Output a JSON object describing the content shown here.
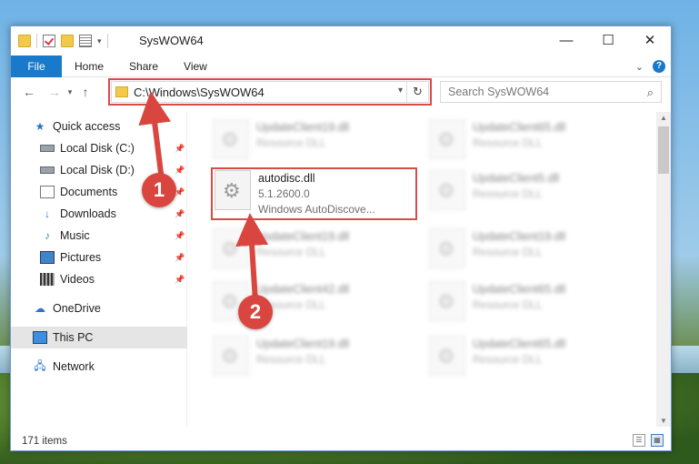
{
  "window": {
    "title": "SysWOW64"
  },
  "controls": {
    "minimize": "—",
    "maximize": "☐",
    "close": "✕"
  },
  "ribbon": {
    "tabs": [
      "File",
      "Home",
      "Share",
      "View"
    ],
    "collapse": "⌄",
    "help": "?"
  },
  "address": {
    "path": "C:\\Windows\\SysWOW64"
  },
  "search": {
    "placeholder": "Search SysWOW64"
  },
  "nav": {
    "quick_access": "Quick access",
    "items": [
      "Local Disk (C:)",
      "Local Disk (D:)",
      "Documents",
      "Downloads",
      "Music",
      "Pictures",
      "Videos"
    ],
    "onedrive": "OneDrive",
    "this_pc": "This PC",
    "network": "Network"
  },
  "files": [
    {
      "name": "UpdateClient19.dll",
      "sub": "Resource DLL"
    },
    {
      "name": "UpdateClient65.dll",
      "sub": "Resource DLL"
    },
    {
      "name": "autodisc.dll",
      "version": "5.1.2600.0",
      "desc": "Windows AutoDiscove..."
    },
    {
      "name": "UpdateClient5.dll",
      "sub": "Resource DLL"
    },
    {
      "name": "UpdateClient19.dll",
      "sub": "Resource DLL"
    },
    {
      "name": "UpdateClient19.dll",
      "sub": "Resource DLL"
    },
    {
      "name": "UpdateClient42.dll",
      "sub": "Resource DLL"
    },
    {
      "name": "UpdateClient65.dll",
      "sub": "Resource DLL"
    },
    {
      "name": "UpdateClient19.dll",
      "sub": "Resource DLL"
    },
    {
      "name": "UpdateClient65.dll",
      "sub": "Resource DLL"
    }
  ],
  "status": {
    "count": "171 items"
  },
  "callouts": [
    "1",
    "2"
  ],
  "colors": {
    "accent": "#1979ca",
    "callout": "#d9463f",
    "highlight_box": "#d94a4a"
  }
}
